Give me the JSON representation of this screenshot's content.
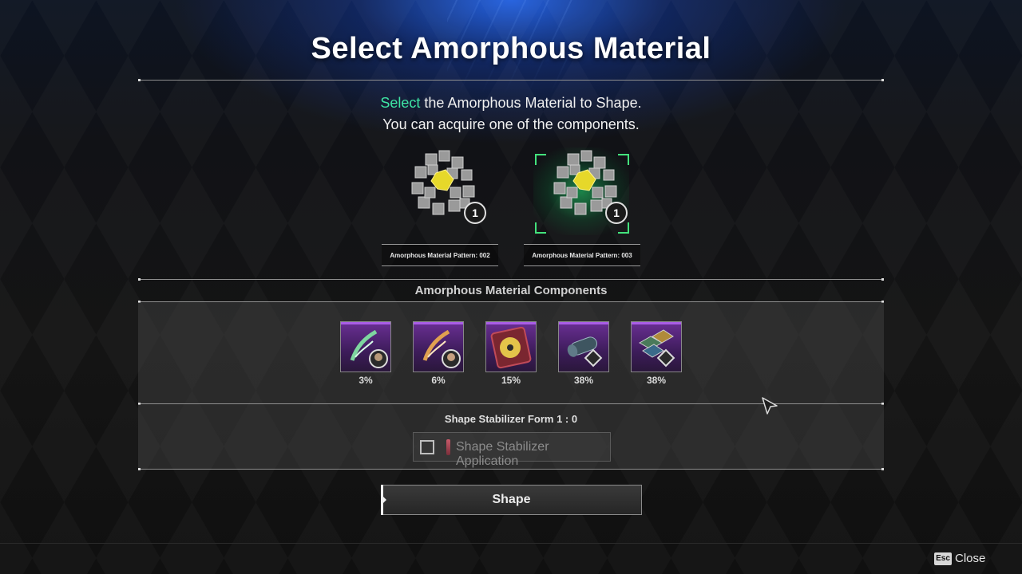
{
  "screen": {
    "title": "Select Amorphous Material",
    "instruction": {
      "highlight": "Select",
      "line1_rest": " the Amorphous Material to Shape.",
      "line2": "You can acquire one of the components."
    }
  },
  "materials": [
    {
      "label": "Amorphous Material Pattern: 002",
      "count": "1",
      "selected": false
    },
    {
      "label": "Amorphous Material Pattern: 003",
      "count": "1",
      "selected": true
    }
  ],
  "components_section": {
    "title": "Amorphous Material Components",
    "items": [
      {
        "icon": "character-blueprint-icon",
        "chance": "3%"
      },
      {
        "icon": "character-blueprint-icon",
        "chance": "6%"
      },
      {
        "icon": "disc-item-icon",
        "chance": "15%"
      },
      {
        "icon": "roll-item-icon",
        "chance": "38%"
      },
      {
        "icon": "hex-item-icon",
        "chance": "38%"
      }
    ]
  },
  "stabilizer": {
    "title": "Shape Stabilizer Form 1 : 0",
    "option_label": "Shape Stabilizer Application",
    "checked": false
  },
  "actions": {
    "shape_label": "Shape"
  },
  "footer": {
    "esc_key": "Esc",
    "close_label": "Close"
  },
  "colors": {
    "highlight": "#3ee6a5",
    "selection": "#43e27c",
    "rarity_purple": "#a95ee6"
  }
}
